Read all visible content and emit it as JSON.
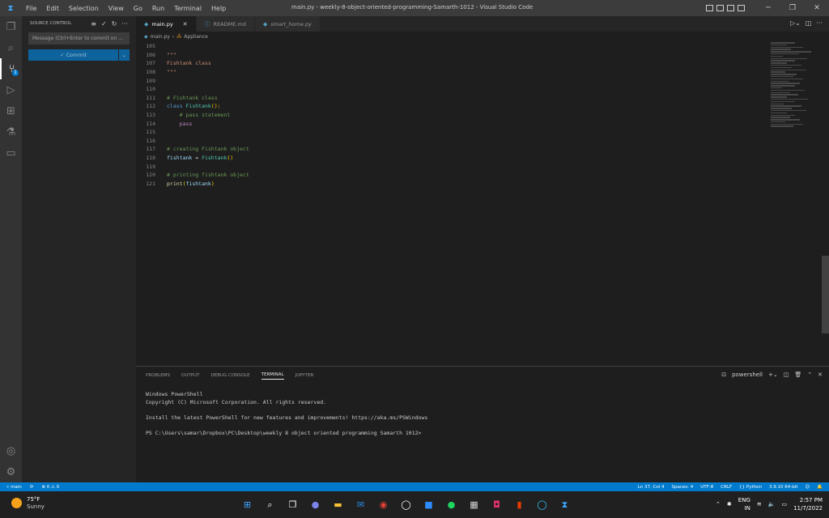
{
  "window": {
    "title": "main.py - weekly-8-object-oriented-programming-Samarth-1012 - Visual Studio Code",
    "menu": [
      "File",
      "Edit",
      "Selection",
      "View",
      "Go",
      "Run",
      "Terminal",
      "Help"
    ]
  },
  "sidebar": {
    "header": "SOURCE CONTROL",
    "message_placeholder": "Message (Ctrl+Enter to commit on ...",
    "commit_label": "✓ Commit",
    "scm_badge": "1"
  },
  "tabs": [
    {
      "label": "main.py",
      "icon": "python-icon",
      "active": true
    },
    {
      "label": "README.md",
      "icon": "info-icon",
      "active": false
    },
    {
      "label": "smart_home.py",
      "icon": "python-icon",
      "active": false
    }
  ],
  "breadcrumb": {
    "file": "main.py",
    "symbol": "Appliance"
  },
  "editor": {
    "lines": [
      {
        "n": "105",
        "text": ""
      },
      {
        "n": "106",
        "text": "\"\"\""
      },
      {
        "n": "107",
        "text": "Fishtank class"
      },
      {
        "n": "108",
        "text": "\"\"\""
      },
      {
        "n": "109",
        "text": ""
      },
      {
        "n": "110",
        "text": ""
      },
      {
        "n": "111",
        "text": "# Fishtank class"
      },
      {
        "n": "112",
        "text": "class Fishtank():"
      },
      {
        "n": "113",
        "text": "    # pass statement"
      },
      {
        "n": "114",
        "text": "    pass"
      },
      {
        "n": "115",
        "text": ""
      },
      {
        "n": "116",
        "text": ""
      },
      {
        "n": "117",
        "text": "# creating Fishtank object"
      },
      {
        "n": "118",
        "text": "fishtank = Fishtank()"
      },
      {
        "n": "119",
        "text": ""
      },
      {
        "n": "120",
        "text": "# printing fishtank object"
      },
      {
        "n": "121",
        "text": "print(fishtank)"
      }
    ]
  },
  "panel": {
    "tabs": [
      "PROBLEMS",
      "OUTPUT",
      "DEBUG CONSOLE",
      "TERMINAL",
      "JUPYTER"
    ],
    "active_tab": "TERMINAL",
    "shell": "powershell",
    "terminal_lines": [
      "Windows PowerShell",
      "Copyright (C) Microsoft Corporation. All rights reserved.",
      "",
      "Install the latest PowerShell for new features and improvements! https://aka.ms/PSWindows",
      "",
      "PS C:\\Users\\samar\\Dropbox\\PC\\Desktop\\weekly 8 object oriented programming Samarth 1012>"
    ]
  },
  "status": {
    "branch": "main",
    "problems": "⊗ 0 ⚠ 0",
    "position": "Ln 37, Col 4",
    "spaces": "Spaces: 4",
    "encoding": "UTF-8",
    "eol": "CRLF",
    "language": "Python",
    "interpreter": "3.9.10 64-bit"
  },
  "taskbar": {
    "temp": "75°F",
    "condition": "Sunny",
    "lang": "ENG",
    "region": "IN",
    "time": "2:57 PM",
    "date": "11/7/2022"
  }
}
